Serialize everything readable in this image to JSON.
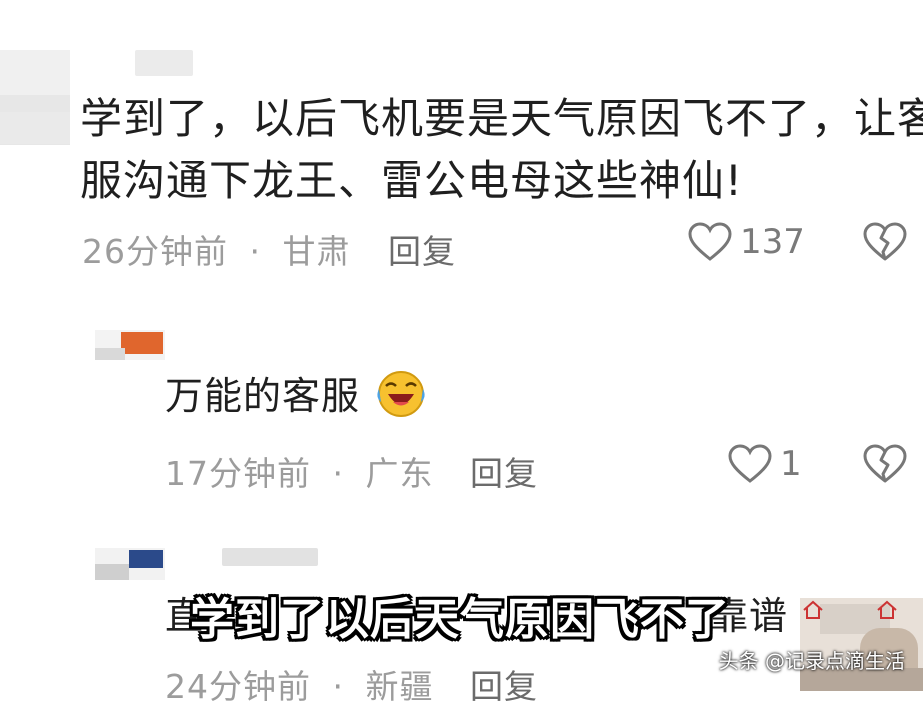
{
  "comments": [
    {
      "text_line1": "学到了，以后飞机要是天气原因飞不了，让客",
      "text_line2": "服沟通下龙王、雷公电母这些神仙!",
      "time": "26分钟前",
      "separator": "·",
      "location": "甘肃",
      "reply_label": "回复",
      "likes": "137"
    },
    {
      "text": "万能的客服",
      "emoji": "laugh-cry-emoji",
      "time": "17分钟前",
      "separator": "·",
      "location": "广东",
      "reply_label": "回复",
      "likes": "1"
    },
    {
      "text_partial_left": "直",
      "text_partial_right": "靠谱",
      "time": "24分钟前",
      "separator": "·",
      "location": "新疆",
      "reply_label": "回复"
    }
  ],
  "caption": "学到了以后天气原因飞不了",
  "watermark": "头条 @记录点滴生活",
  "colors": {
    "meta_gray": "#9c9c9c",
    "caption_fill": "#ffffff",
    "caption_stroke": "#000000",
    "avatar_orange": "#e0662d",
    "avatar_blue": "#2b4a8a"
  }
}
